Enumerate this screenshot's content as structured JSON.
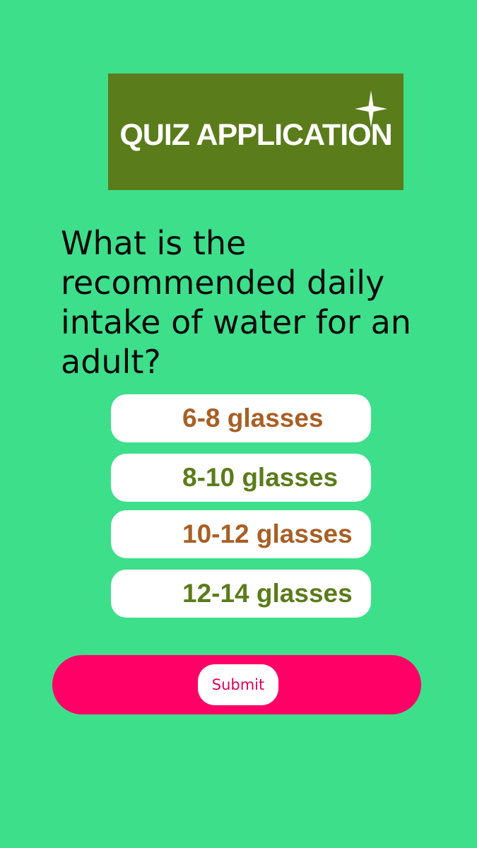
{
  "header": {
    "title": "QUIZ APPLICATION",
    "background_color": "#5b7c1a",
    "sparkle_icon": "four-point-star"
  },
  "question": {
    "text": "What is the recommended daily intake of water for an adult?"
  },
  "options": [
    {
      "label": "6-8 glasses",
      "color": "#a85f25"
    },
    {
      "label": "8-10 glasses",
      "color": "#5b7c1a"
    },
    {
      "label": "10-12 glasses",
      "color": "#a85f25"
    },
    {
      "label": "12-14 glasses",
      "color": "#5b7c1a"
    }
  ],
  "submit": {
    "label": "Submit",
    "text_color": "#e0005a",
    "bar_color": "#ff0066"
  },
  "theme": {
    "background": "#3ddf8b"
  }
}
